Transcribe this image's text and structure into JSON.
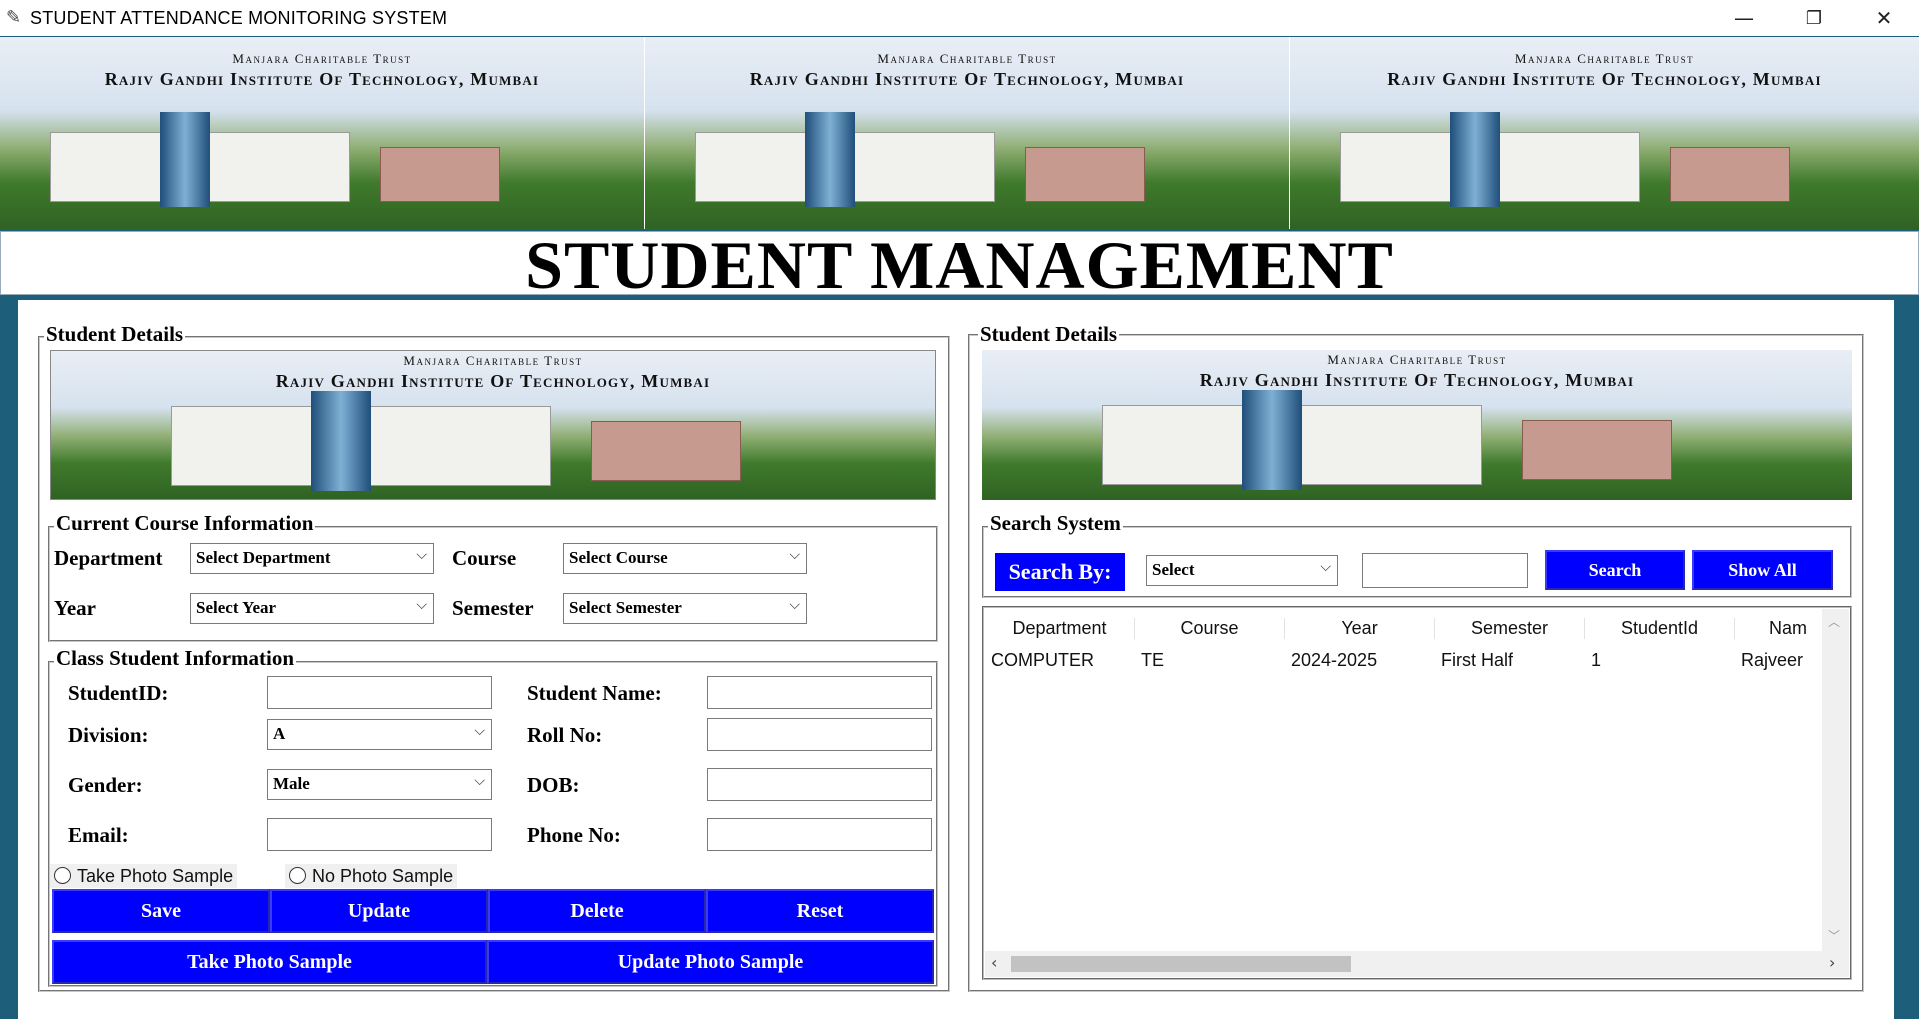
{
  "window": {
    "title": "STUDENT ATTENDANCE MONITORING SYSTEM",
    "minimize_glyph": "—",
    "restore_glyph": "❐",
    "close_glyph": "✕"
  },
  "banner": {
    "trust": "Manjara Charitable Trust",
    "institute": "Rajiv Gandhi Institute Of Technology, Mumbai"
  },
  "page_title": "STUDENT MANAGEMENT",
  "left": {
    "legend": "Student Details",
    "course": {
      "legend": "Current Course Information",
      "department_label": "Department",
      "department_value": "Select Department",
      "course_label": "Course",
      "course_value": "Select Course",
      "year_label": "Year",
      "year_value": "Select Year",
      "semester_label": "Semester",
      "semester_value": "Select Semester"
    },
    "class": {
      "legend": "Class Student Information",
      "student_id_label": "StudentID:",
      "student_id_value": "",
      "student_name_label": "Student Name:",
      "student_name_value": "",
      "division_label": "Division:",
      "division_value": "A",
      "roll_label": "Roll No:",
      "roll_value": "",
      "gender_label": "Gender:",
      "gender_value": "Male",
      "dob_label": "DOB:",
      "dob_value": "",
      "email_label": "Email:",
      "email_value": "",
      "phone_label": "Phone No:",
      "phone_value": "",
      "radio_take": "Take Photo Sample",
      "radio_no": "No Photo Sample"
    },
    "buttons": {
      "save": "Save",
      "update": "Update",
      "delete": "Delete",
      "reset": "Reset",
      "take_photo": "Take Photo Sample",
      "update_photo": "Update Photo Sample"
    }
  },
  "right": {
    "legend": "Student Details",
    "search": {
      "legend": "Search System",
      "search_by_label": "Search By:",
      "select_value": "Select",
      "query": "",
      "search_button": "Search",
      "show_all_button": "Show All"
    },
    "table": {
      "columns": [
        "Department",
        "Course",
        "Year",
        "Semester",
        "StudentId",
        "Nam"
      ],
      "rows": [
        [
          "COMPUTER",
          "TE",
          "2024-2025",
          "First Half",
          "1",
          "Rajveer"
        ]
      ]
    }
  },
  "colors": {
    "button_blue": "#0000ff",
    "button_text": "#ffffff",
    "background_teal": "#1d5f7a"
  }
}
